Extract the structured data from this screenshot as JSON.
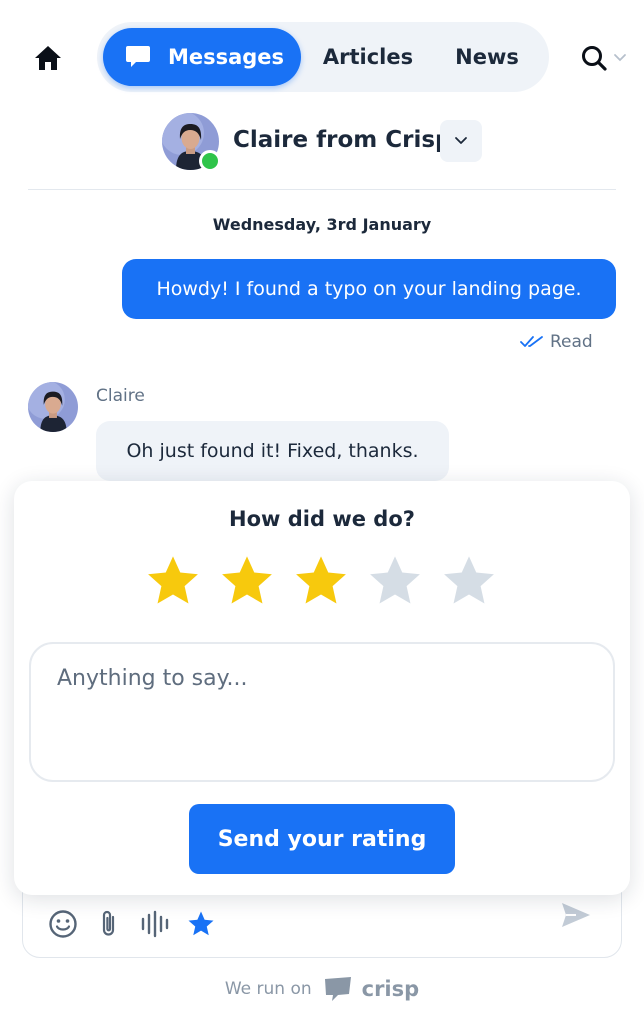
{
  "header": {
    "tabs": [
      {
        "label": "Messages",
        "active": true
      },
      {
        "label": "Articles",
        "active": false
      },
      {
        "label": "News",
        "active": false
      }
    ],
    "icons": {
      "home": "home-icon",
      "messages": "chat-bubble-icon",
      "search": "search-icon",
      "search_menu": "chevron-down-icon"
    }
  },
  "operator": {
    "name": "Claire from Crisp",
    "status": "online",
    "dropdown_icon": "chevron-down-icon"
  },
  "conversation": {
    "date": "Wednesday, 3rd January",
    "messages": [
      {
        "from": "visitor",
        "text": "Howdy! I found a typo on your landing page.",
        "status": "Read"
      },
      {
        "from": "operator",
        "sender": "Claire",
        "text": "Oh just found it! Fixed, thanks."
      }
    ]
  },
  "rating": {
    "title": "How did we do?",
    "stars_total": 5,
    "stars_selected": 3,
    "comment_placeholder": "Anything to say...",
    "submit_label": "Send your rating"
  },
  "composer": {
    "tools": [
      "emoji-icon",
      "paperclip-icon",
      "audio-wave-icon",
      "star-icon"
    ],
    "send_icon": "send-icon"
  },
  "footer": {
    "text": "We run on",
    "brand": "crisp"
  },
  "colors": {
    "accent": "#1972f5",
    "star_active": "#f7c90d",
    "star_inactive": "#d5dde5",
    "online": "#2fc44a"
  }
}
